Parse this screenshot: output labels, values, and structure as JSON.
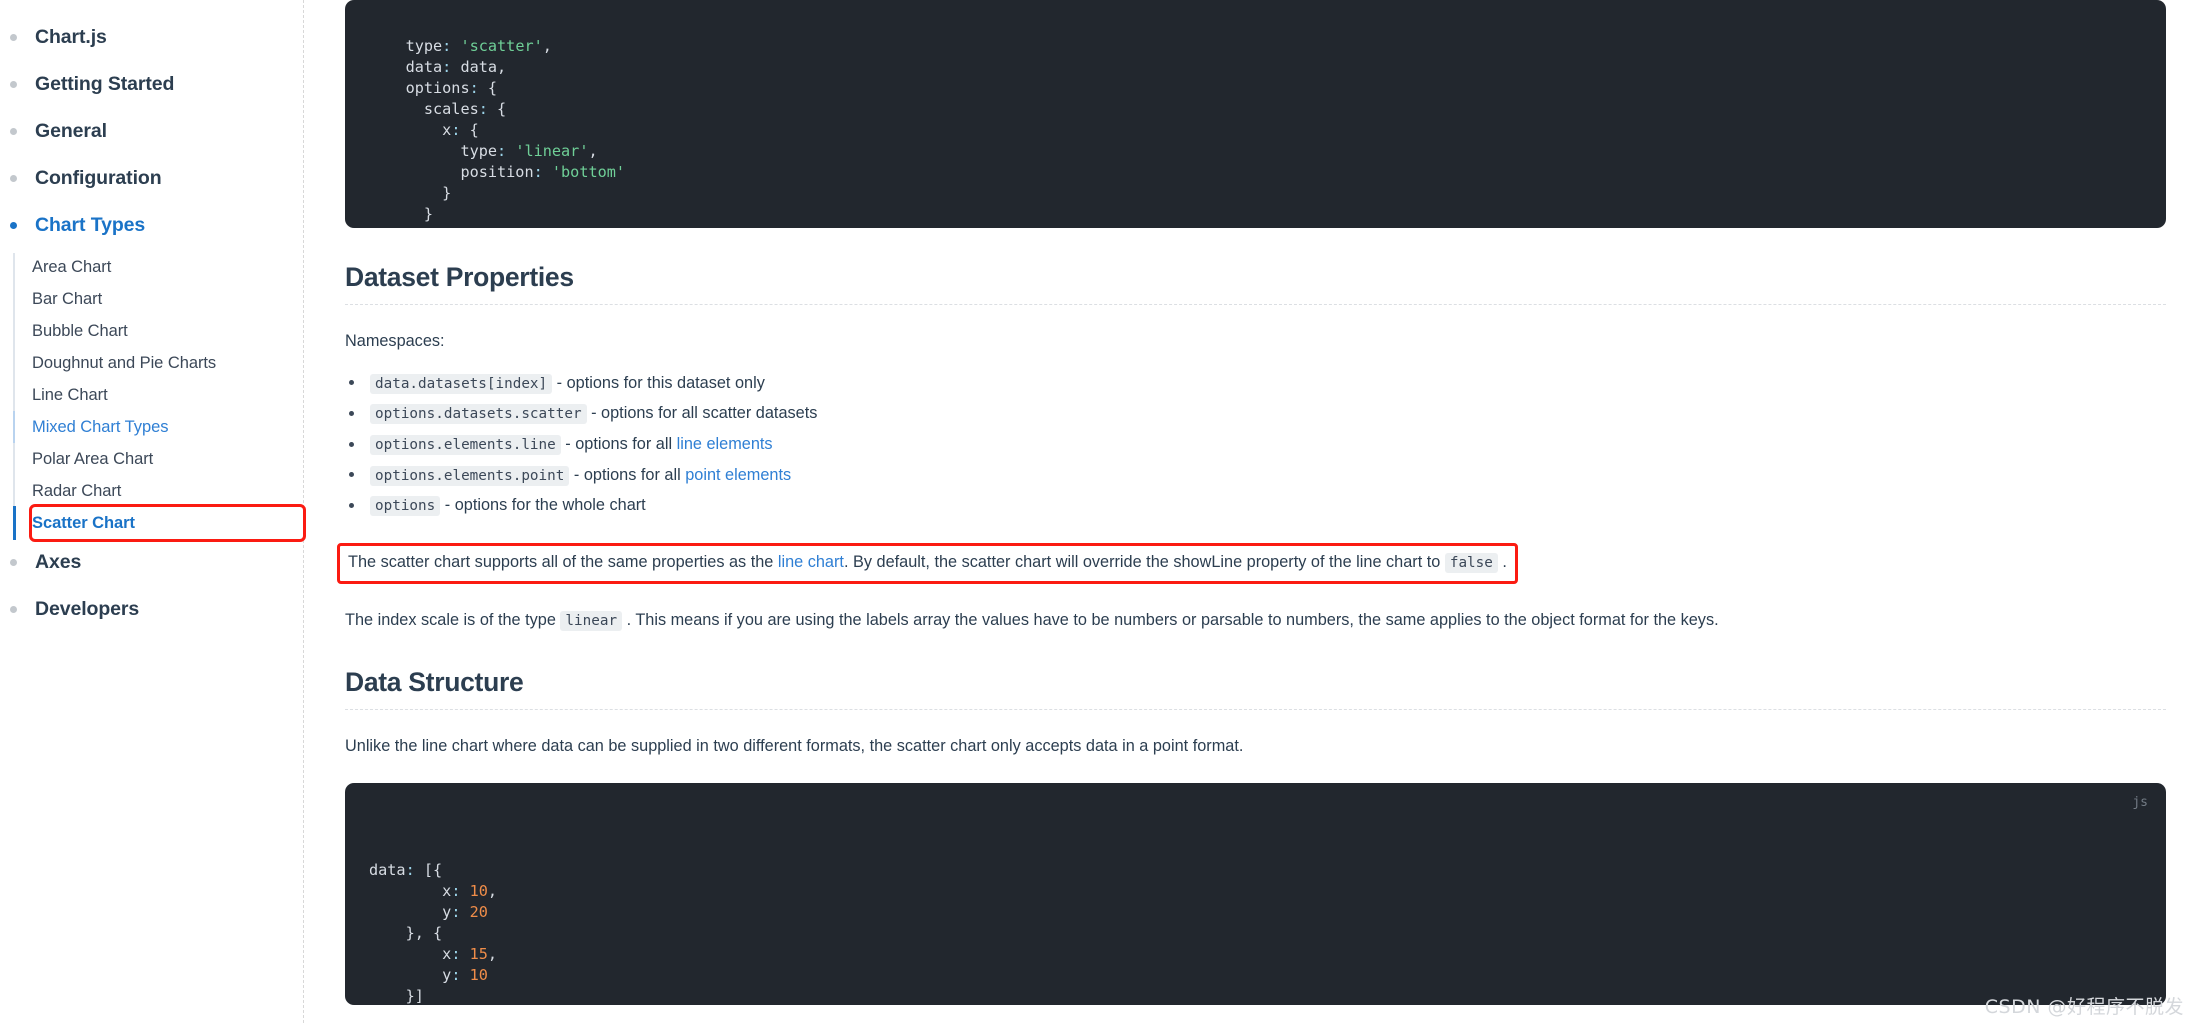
{
  "sidebar": {
    "top_items": [
      {
        "label": "Chart.js",
        "active": false
      },
      {
        "label": "Getting Started",
        "active": false
      },
      {
        "label": "General",
        "active": false
      },
      {
        "label": "Configuration",
        "active": false
      },
      {
        "label": "Chart Types",
        "active": true
      }
    ],
    "sub_items": [
      {
        "label": "Area Chart",
        "state": "normal"
      },
      {
        "label": "Bar Chart",
        "state": "normal"
      },
      {
        "label": "Bubble Chart",
        "state": "normal"
      },
      {
        "label": "Doughnut and Pie Charts",
        "state": "normal"
      },
      {
        "label": "Line Chart",
        "state": "normal"
      },
      {
        "label": "Mixed Chart Types",
        "state": "link"
      },
      {
        "label": "Polar Area Chart",
        "state": "normal"
      },
      {
        "label": "Radar Chart",
        "state": "normal"
      },
      {
        "label": "Scatter Chart",
        "state": "current"
      }
    ],
    "bottom_items": [
      {
        "label": "Axes",
        "active": false
      },
      {
        "label": "Developers",
        "active": false
      }
    ],
    "accent_color": "#1a73c7",
    "highlight_box_color": "#fb1b12"
  },
  "code_top": {
    "lines": [
      {
        "indent": 4,
        "parts": [
          {
            "t": "type",
            "c": "key"
          },
          {
            "t": ": ",
            "c": "punc"
          },
          {
            "t": "'scatter'",
            "c": "str"
          },
          {
            "t": ",",
            "c": "plain"
          }
        ]
      },
      {
        "indent": 4,
        "parts": [
          {
            "t": "data",
            "c": "key"
          },
          {
            "t": ": ",
            "c": "punc"
          },
          {
            "t": "data,",
            "c": "plain"
          }
        ]
      },
      {
        "indent": 4,
        "parts": [
          {
            "t": "options",
            "c": "key"
          },
          {
            "t": ": ",
            "c": "punc"
          },
          {
            "t": "{",
            "c": "plain"
          }
        ]
      },
      {
        "indent": 6,
        "parts": [
          {
            "t": "scales",
            "c": "key"
          },
          {
            "t": ": ",
            "c": "punc"
          },
          {
            "t": "{",
            "c": "plain"
          }
        ]
      },
      {
        "indent": 8,
        "parts": [
          {
            "t": "x",
            "c": "key"
          },
          {
            "t": ": ",
            "c": "punc"
          },
          {
            "t": "{",
            "c": "plain"
          }
        ]
      },
      {
        "indent": 10,
        "parts": [
          {
            "t": "type",
            "c": "key"
          },
          {
            "t": ": ",
            "c": "punc"
          },
          {
            "t": "'linear'",
            "c": "str"
          },
          {
            "t": ",",
            "c": "plain"
          }
        ]
      },
      {
        "indent": 10,
        "parts": [
          {
            "t": "position",
            "c": "key"
          },
          {
            "t": ": ",
            "c": "punc"
          },
          {
            "t": "'bottom'",
            "c": "str"
          }
        ]
      },
      {
        "indent": 8,
        "parts": [
          {
            "t": "}",
            "c": "plain"
          }
        ]
      },
      {
        "indent": 6,
        "parts": [
          {
            "t": "}",
            "c": "plain"
          }
        ]
      },
      {
        "indent": 4,
        "parts": [
          {
            "t": "}",
            "c": "plain"
          }
        ]
      },
      {
        "indent": 2,
        "parts": [
          {
            "t": "};",
            "c": "plain"
          }
        ]
      }
    ]
  },
  "dataset_properties": {
    "heading": "Dataset Properties",
    "intro": "Namespaces:",
    "namespaces": [
      {
        "code": "data.datasets[index]",
        "text_before": " - options for this dataset only",
        "link": null,
        "text_after": ""
      },
      {
        "code": "options.datasets.scatter",
        "text_before": " - options for all scatter datasets",
        "link": null,
        "text_after": ""
      },
      {
        "code": "options.elements.line",
        "text_before": " - options for all ",
        "link": "line elements",
        "text_after": ""
      },
      {
        "code": "options.elements.point",
        "text_before": " - options for all ",
        "link": "point elements",
        "text_after": ""
      },
      {
        "code": "options",
        "text_before": " - options for the whole chart",
        "link": null,
        "text_after": ""
      }
    ],
    "highlighted_note": {
      "part1": "The scatter chart supports all of the same properties as the ",
      "link": "line chart",
      "part2": ". By default, the scatter chart will override the showLine property of the line chart to ",
      "code": "false",
      "part3": "."
    },
    "index_scale_note": {
      "part1": "The index scale is of the type ",
      "code": "linear",
      "part2": ". This means if you are using the labels array the values have to be numbers or parsable to numbers, the same applies to the object format for the keys."
    }
  },
  "data_structure": {
    "heading": "Data Structure",
    "paragraph": "Unlike the line chart where data can be supplied in two different formats, the scatter chart only accepts data in a point format.",
    "code_lang": "js",
    "lines": [
      {
        "indent": 0,
        "parts": [
          {
            "t": "data",
            "c": "key"
          },
          {
            "t": ": ",
            "c": "punc"
          },
          {
            "t": "[{",
            "c": "plain"
          }
        ]
      },
      {
        "indent": 8,
        "parts": [
          {
            "t": "x",
            "c": "key"
          },
          {
            "t": ": ",
            "c": "punc"
          },
          {
            "t": "10",
            "c": "num"
          },
          {
            "t": ",",
            "c": "plain"
          }
        ]
      },
      {
        "indent": 8,
        "parts": [
          {
            "t": "y",
            "c": "key"
          },
          {
            "t": ": ",
            "c": "punc"
          },
          {
            "t": "20",
            "c": "num"
          }
        ]
      },
      {
        "indent": 4,
        "parts": [
          {
            "t": "}, {",
            "c": "plain"
          }
        ]
      },
      {
        "indent": 8,
        "parts": [
          {
            "t": "x",
            "c": "key"
          },
          {
            "t": ": ",
            "c": "punc"
          },
          {
            "t": "15",
            "c": "num"
          },
          {
            "t": ",",
            "c": "plain"
          }
        ]
      },
      {
        "indent": 8,
        "parts": [
          {
            "t": "y",
            "c": "key"
          },
          {
            "t": ": ",
            "c": "punc"
          },
          {
            "t": "10",
            "c": "num"
          }
        ]
      },
      {
        "indent": 4,
        "parts": [
          {
            "t": "}]",
            "c": "plain"
          }
        ]
      }
    ]
  },
  "watermark": "CSDN @好程序不脱发"
}
